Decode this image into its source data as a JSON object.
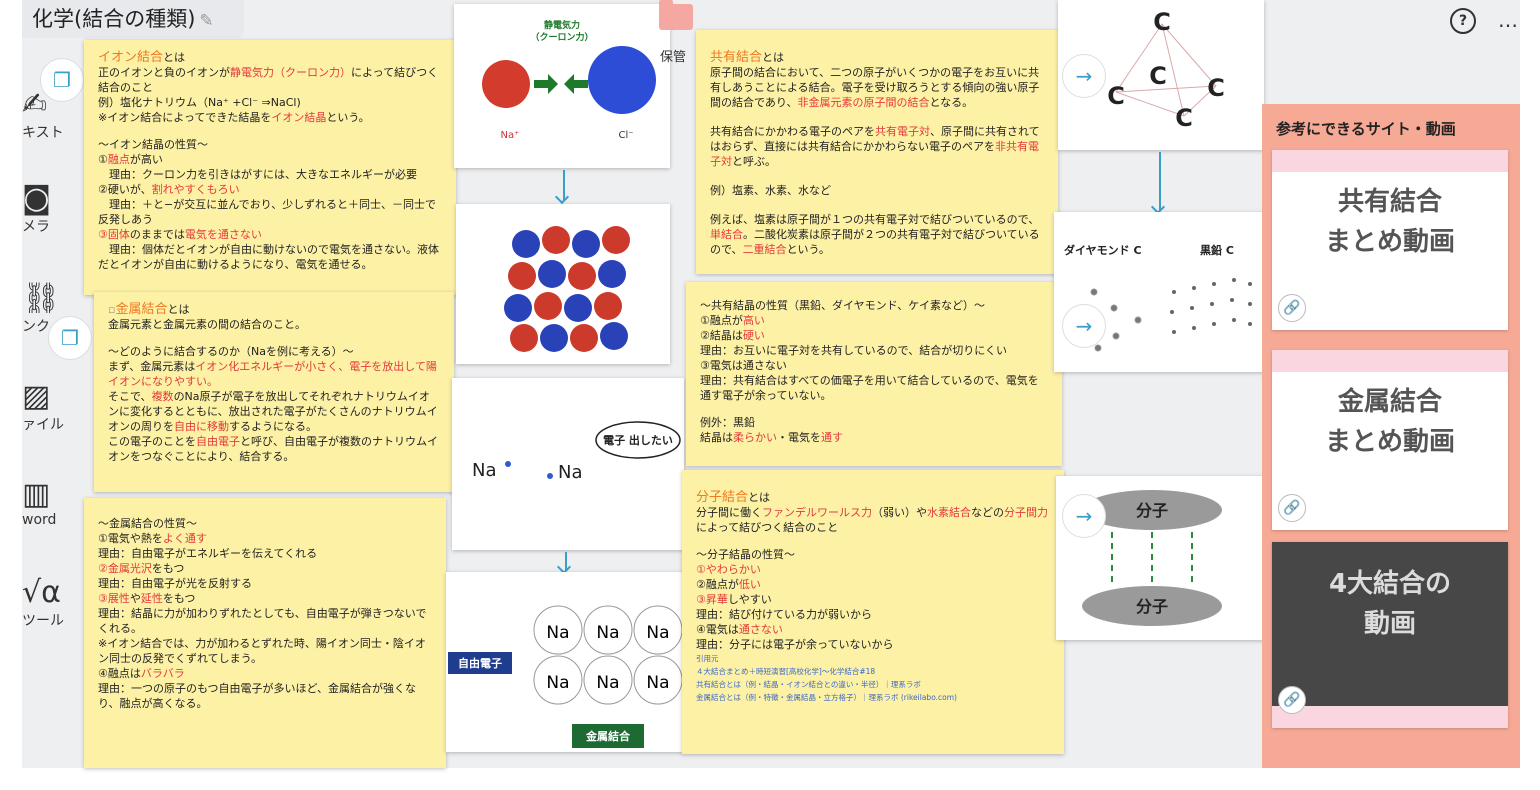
{
  "header": {
    "title": "化学(結合の種類)",
    "help": "?",
    "more": "…"
  },
  "tools": {
    "text": "キスト",
    "camera": "メラ",
    "link": "ンク",
    "file": "ァイル",
    "word": "word",
    "tool": "ツール"
  },
  "folder_label": "保管",
  "ionic": {
    "head": "イオン結合",
    "head_suffix": "とは",
    "l1": "正のイオンと負のイオンが",
    "l1r": "静電気力（クーロン力）",
    "l1b": "によって結びつく結合のこと",
    "l2": "例）塩化ナトリウム（Na⁺ +Cl⁻ ⇒NaCl)",
    "l3": "※イオン結合によってできた結晶を",
    "l3r": "イオン結晶",
    "l3b": "という。",
    "l4": "〜イオン結晶の性質〜",
    "p1": "①",
    "p1r": "融点",
    "p1b": "が高い",
    "p1x": "　理由：クーロン力を引きはがすには、大きなエネルギーが必要",
    "p2": "②硬いが、",
    "p2r": "割れやすくもろい",
    "p2x": "　理由：＋と−が交互に並んでおり、少しずれると＋同士、－同士で反発しあう",
    "p3r": "③固体",
    "p3": "のままでは",
    "p3r2": "電気を通さない",
    "p3x": "　理由：個体だとイオンが自由に動けないので電気を通さない。液体だとイオンが自由に動けるようになり、電気を通せる。"
  },
  "metal": {
    "head": "金属結合",
    "head_suffix": "とは",
    "l1": "金属元素と金属元素の間の結合のこと。",
    "l2": "〜どのように結合するのか（Naを例に考える）〜",
    "l3": "まず、金属元素は",
    "l3r": "イオン化エネルギーが小さく、電子を放出して陽イオンになりやすい。",
    "l4": "そこで、",
    "l4r": "複数",
    "l4b": "のNa原子が電子を放出してそれぞれナトリウムイオンに変化するとともに、放出された電子がたくさんのナトリウムイオンの周りを",
    "l4r2": "自由に移動",
    "l4c": "するようになる。",
    "l5": "この電子のことを",
    "l5r": "自由電子",
    "l5b": "と呼び、自由電子が複数のナトリウムイオンをつなぐことにより、結合する。"
  },
  "metal_props": {
    "l0": "〜金属結合の性質〜",
    "a1": "①電気や熱を",
    "a1r": "よく通す",
    "a1x": "理由：自由電子がエネルギーを伝えてくれる",
    "a2r": "②金属光沢",
    "a2": "をもつ",
    "a2x": "理由：自由電子が光を反射する",
    "a3r": "③展性",
    "a3": "や",
    "a3r2": "延性",
    "a3b": "をもつ",
    "a3x": "理由：結晶に力が加わりずれたとしても、自由電子が弾きつないでくれる。",
    "a3y": "※イオン結合では、力が加わるとずれた時、陽イオン同士・陰イオン同士の反発でくずれてしまう。",
    "a4": "④融点は",
    "a4r": "バラバラ",
    "a4x": "理由：一つの原子のもつ自由電子が多いほど、金属結合が強くなり、融点が高くなる。"
  },
  "covalent": {
    "head": "共有結合",
    "head_suffix": "とは",
    "l1": "原子間の結合において、二つの原子がいくつかの電子をお互いに共有しあうことによる結合。電子を受け取ろうとする傾向の強い原子間の結合であり、",
    "l1r": "非金属元素の原子間の結合",
    "l1b": "となる。",
    "l2": "共有結合にかかわる電子のペアを",
    "l2r": "共有電子対",
    "l2b": "、原子間に共有されてはおらず、直接には共有結合にかかわらない電子のペアを",
    "l2r2": "非共有電子対",
    "l2c": "と呼ぶ。",
    "l3": "例）塩素、水素、水など",
    "l4": "例えば、塩素は原子間が１つの共有電子対で結びついているので、",
    "l4r": "単結合",
    "l4b": "。二酸化炭素は原子間が２つの共有電子対で結びついているので、",
    "l4r2": "二重結合",
    "l4c": "という。"
  },
  "cov_props": {
    "l0": "〜共有結晶の性質（黒鉛、ダイヤモンド、ケイ素など）〜",
    "a1": "①融点が",
    "a1r": "高い",
    "a2": "②結晶は",
    "a2r": "硬い",
    "a2x": "理由：お互いに電子対を共有しているので、結合が切りにくい",
    "a3": "③電気は通さない",
    "a3x": "理由：共有結合はすべての価電子を用いて結合しているので、電気を通す電子が余っていない。",
    "e1": "例外：黒鉛",
    "e2": "結晶は",
    "e2r": "柔らかい",
    "e2b": "・電気を",
    "e2r2": "通す"
  },
  "molecular": {
    "head": "分子結合",
    "head_suffix": "とは",
    "l1": "分子間に働く",
    "l1r": "ファンデルワールス力",
    "l1b": "（弱い）や",
    "l1r2": "水素結合",
    "l1c": "などの",
    "l1r3": "分子間力",
    "l1d": "によって結びつく結合のこと",
    "l2": "〜分子結晶の性質〜",
    "a1r": "①やわらかい",
    "a2": "②融点が",
    "a2r": "低い",
    "a3r": "③昇華",
    "a3": "しやすい",
    "a3x": "理由：結び付けている力が弱いから",
    "a4": "④電気は",
    "a4r": "通さない",
    "a4x": "理由：分子には電子が余っていないから",
    "src": "引用元",
    "s1": "４大結合まとめ＋時短演習[高校化学]〜化学結合#18",
    "s2": "共有結合とは（例・結晶・イオン結合との違い・半径）｜理系ラボ",
    "s3": "金属結合とは（例・特徴・金属結晶・立方格子）｜理系ラボ (rikeilabo.com)"
  },
  "images": {
    "coulomb_title": "静電気力",
    "coulomb_sub": "（クーロン力）",
    "na": "Na⁺",
    "cl": "Cl⁻",
    "na_left": "Na",
    "na_right": "Na",
    "bubble": "電子 出したい",
    "free_electron": "自由電子",
    "metal_bond": "金属結合",
    "na_ion": "Na",
    "diamond": "ダイヤモンド C",
    "graphite": "黒鉛 C",
    "molecule": "分子",
    "carbon": "C"
  },
  "refs": {
    "title": "参考にできるサイト・動画",
    "v1": [
      "共有結合",
      "まとめ動画"
    ],
    "v2": [
      "金属結合",
      "まとめ動画"
    ],
    "v3": [
      "4大結合の",
      "動画"
    ]
  }
}
